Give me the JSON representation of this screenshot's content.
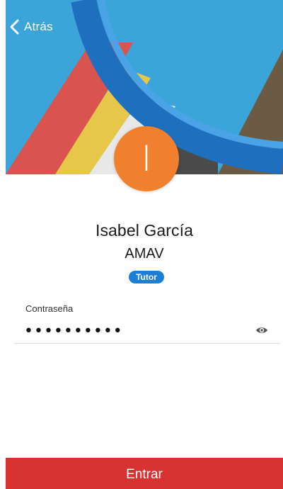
{
  "header": {
    "back_label": "Atrás"
  },
  "profile": {
    "avatar_initial": "I",
    "name": "Isabel García",
    "organization": "AMAV",
    "role": "Tutor"
  },
  "login": {
    "password_label": "Contraseña",
    "password_value": "••••••••••"
  },
  "actions": {
    "submit_label": "Entrar"
  },
  "icons": {
    "back": "chevron-left-icon",
    "toggle_visibility": "eye-icon"
  },
  "colors": {
    "avatar": "#f0802e",
    "badge": "#1b7fd6",
    "submit": "#d83232",
    "sky": "#3ba4d8"
  }
}
